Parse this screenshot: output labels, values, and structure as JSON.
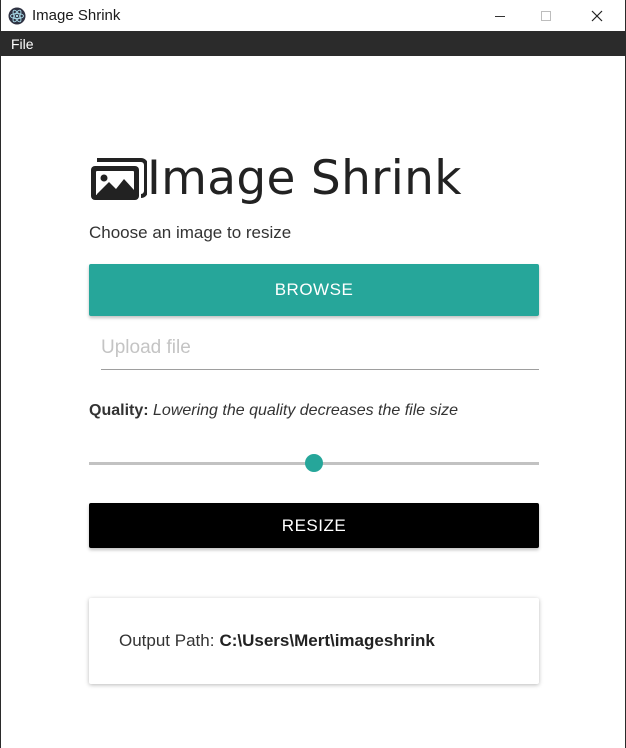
{
  "window": {
    "title": "Image Shrink",
    "controls": {
      "minimize": "—",
      "maximize": "☐",
      "close": "✕"
    }
  },
  "menu": {
    "items": [
      {
        "label": "File"
      }
    ]
  },
  "main": {
    "heading": "Image Shrink",
    "subtitle": "Choose an image to resize",
    "browse_label": "BROWSE",
    "upload_placeholder": "Upload file",
    "upload_value": "",
    "quality_label": "Quality:",
    "quality_hint": "Lowering the quality decreases the file size",
    "quality_value": 50,
    "quality_min": 0,
    "quality_max": 100,
    "resize_label": "RESIZE",
    "output_label": "Output Path:",
    "output_path": "C:\\Users\\Mert\\imageshrink"
  },
  "colors": {
    "accent": "#26a69a",
    "menubar": "#2b2b2b",
    "resize_button": "#000000"
  },
  "icons": {
    "app": "electron-icon",
    "heading": "images-icon"
  }
}
